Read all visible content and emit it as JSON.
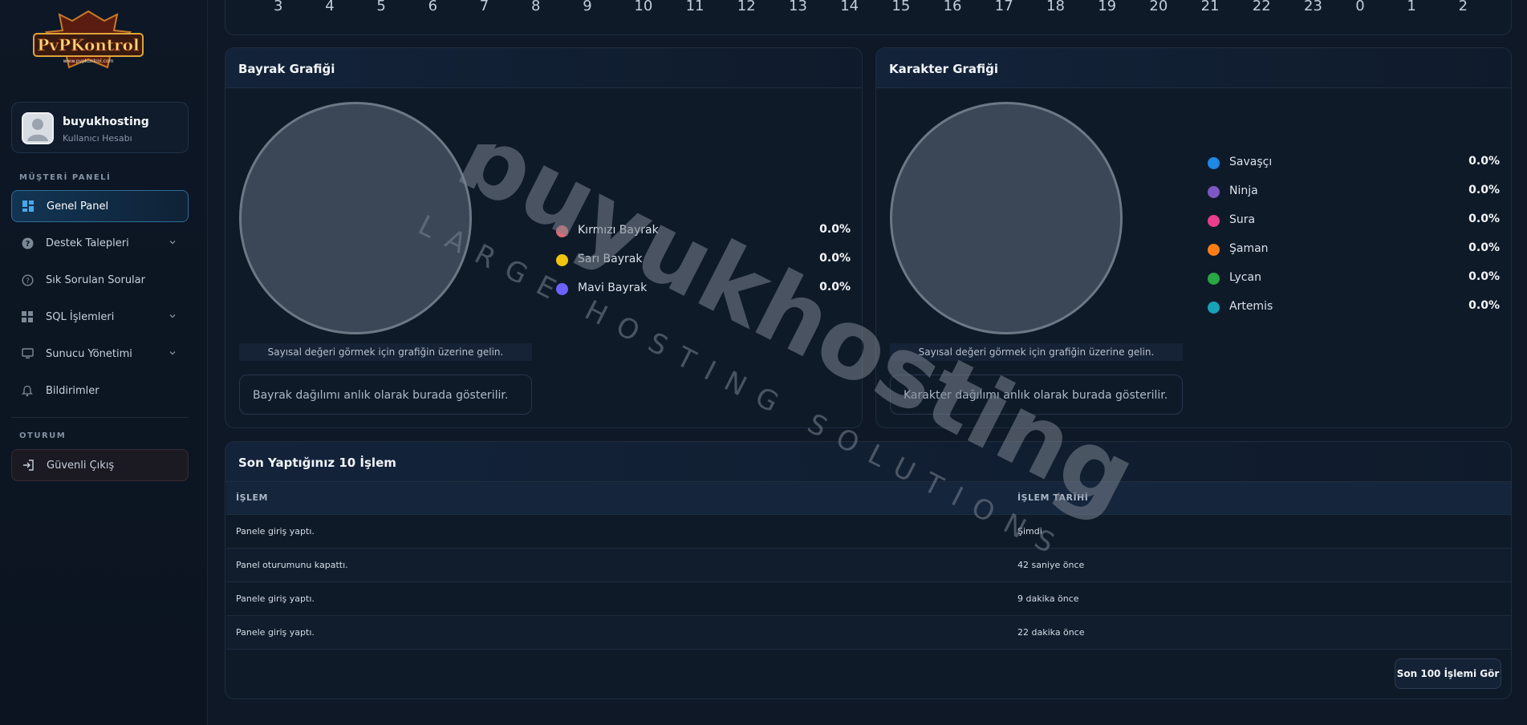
{
  "brand": {
    "logo_text": "PvPKontrol",
    "logo_url_text": "www.pvpkontrol.com"
  },
  "user": {
    "name": "buyukhosting",
    "role": "Kullanıcı Hesabı"
  },
  "sidebar": {
    "section_customer": "MÜŞTERİ PANELİ",
    "section_session": "OTURUM",
    "items": [
      {
        "label": "Genel Panel",
        "icon": "dashboard-icon",
        "active": true
      },
      {
        "label": "Destek Talepleri",
        "icon": "help-circle-icon",
        "expandable": true
      },
      {
        "label": "Sık Sorulan Sorular",
        "icon": "question-circle-icon"
      },
      {
        "label": "SQL İşlemleri",
        "icon": "grid-icon",
        "expandable": true
      },
      {
        "label": "Sunucu Yönetimi",
        "icon": "monitor-icon",
        "expandable": true
      },
      {
        "label": "Bildirimler",
        "icon": "bell-icon"
      }
    ],
    "logout": {
      "label": "Güvenli Çıkış",
      "icon": "logout-icon"
    }
  },
  "top_axis": [
    "3",
    "4",
    "5",
    "6",
    "7",
    "8",
    "9",
    "10",
    "11",
    "12",
    "13",
    "14",
    "15",
    "16",
    "17",
    "18",
    "19",
    "20",
    "21",
    "22",
    "23",
    "0",
    "1",
    "2"
  ],
  "flag_chart": {
    "title": "Bayrak Grafiği",
    "hint": "Sayısal değeri görmek için grafiğin üzerine gelin.",
    "info": "Bayrak dağılımı anlık olarak burada gösterilir.",
    "legend": [
      {
        "label": "Kırmızı Bayrak",
        "value": "0.0%",
        "color": "#e06a73"
      },
      {
        "label": "Sarı Bayrak",
        "value": "0.0%",
        "color": "#f1c40f"
      },
      {
        "label": "Mavi Bayrak",
        "value": "0.0%",
        "color": "#6c63ff"
      }
    ]
  },
  "char_chart": {
    "title": "Karakter Grafiği",
    "hint": "Sayısal değeri görmek için grafiğin üzerine gelin.",
    "info": "Karakter dağılımı anlık olarak burada gösterilir.",
    "legend": [
      {
        "label": "Savaşçı",
        "value": "0.0%",
        "color": "#1e88e5"
      },
      {
        "label": "Ninja",
        "value": "0.0%",
        "color": "#7e57c2"
      },
      {
        "label": "Sura",
        "value": "0.0%",
        "color": "#e83e8c"
      },
      {
        "label": "Şaman",
        "value": "0.0%",
        "color": "#fd7e14"
      },
      {
        "label": "Lycan",
        "value": "0.0%",
        "color": "#28a745"
      },
      {
        "label": "Artemis",
        "value": "0.0%",
        "color": "#17a2b8"
      }
    ]
  },
  "recent": {
    "title": "Son Yaptığınız 10 İşlem",
    "columns": [
      "İŞLEM",
      "İŞLEM TARİHİ"
    ],
    "rows": [
      [
        "Panele giriş yaptı.",
        "Şimdi"
      ],
      [
        "Panel oturumunu kapattı.",
        "42 saniye önce"
      ],
      [
        "Panele giriş yaptı.",
        "9 dakika önce"
      ],
      [
        "Panele giriş yaptı.",
        "22 dakika önce"
      ]
    ],
    "button": "Son 100 İşlemi Gör"
  },
  "watermark": {
    "main": "buyukhosting",
    "sub": "LARGE HOSTING SOLUTIONS"
  }
}
